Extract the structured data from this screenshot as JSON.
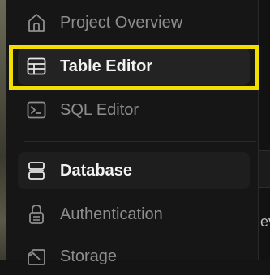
{
  "sidebar": {
    "items": [
      {
        "label": "Project Overview",
        "icon": "home-icon"
      },
      {
        "label": "Table Editor",
        "icon": "table-icon"
      },
      {
        "label": "SQL Editor",
        "icon": "terminal-icon"
      },
      {
        "label": "Database",
        "icon": "database-icon"
      },
      {
        "label": "Authentication",
        "icon": "lock-icon"
      },
      {
        "label": "Storage",
        "icon": "storage-icon"
      }
    ]
  },
  "right_panel": {
    "partial_text": "ev"
  },
  "colors": {
    "highlight": "#f2de00",
    "sidebar_bg": "#161616",
    "active_text": "#f2f2f2",
    "muted_text": "#8e8e8e"
  }
}
